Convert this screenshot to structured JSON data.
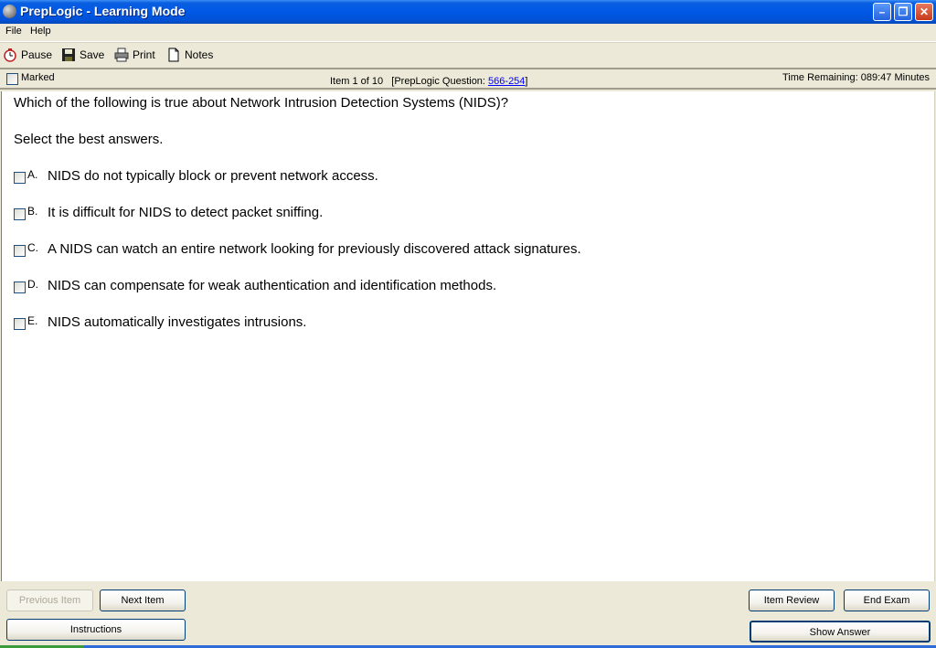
{
  "window": {
    "title": "PrepLogic - Learning Mode",
    "controls": [
      "minimize",
      "restore",
      "close"
    ]
  },
  "menu": {
    "items": [
      "File",
      "Help"
    ]
  },
  "toolbar": {
    "pause_label": "Pause",
    "save_label": "Save",
    "print_label": "Print",
    "notes_label": "Notes"
  },
  "infobar": {
    "marked_label": "Marked",
    "marked_checked": false,
    "item_prefix": "Item 1 of 10   [PrepLogic Question: ",
    "question_id": "566-254",
    "item_suffix": "]",
    "time_remaining": "Time Remaining: 089:47 Minutes"
  },
  "question": {
    "text": "Which of the following is true about Network Intrusion Detection Systems (NIDS)?",
    "instruction": "Select the best answers.",
    "options": [
      {
        "letter": "A.",
        "text": "NIDS do not typically block or prevent network access.",
        "checked": false
      },
      {
        "letter": "B.",
        "text": "It is difficult for NIDS to detect packet sniffing.",
        "checked": false
      },
      {
        "letter": "C.",
        "text": "A NIDS can watch an entire network looking for previously discovered attack signatures.",
        "checked": false
      },
      {
        "letter": "D.",
        "text": "NIDS can compensate for weak authentication and identification methods.",
        "checked": false
      },
      {
        "letter": "E.",
        "text": "NIDS automatically investigates intrusions.",
        "checked": false
      }
    ]
  },
  "buttons": {
    "previous": "Previous Item",
    "next": "Next Item",
    "instructions": "Instructions",
    "item_review": "Item Review",
    "end_exam": "End Exam",
    "show_answer": "Show Answer"
  }
}
